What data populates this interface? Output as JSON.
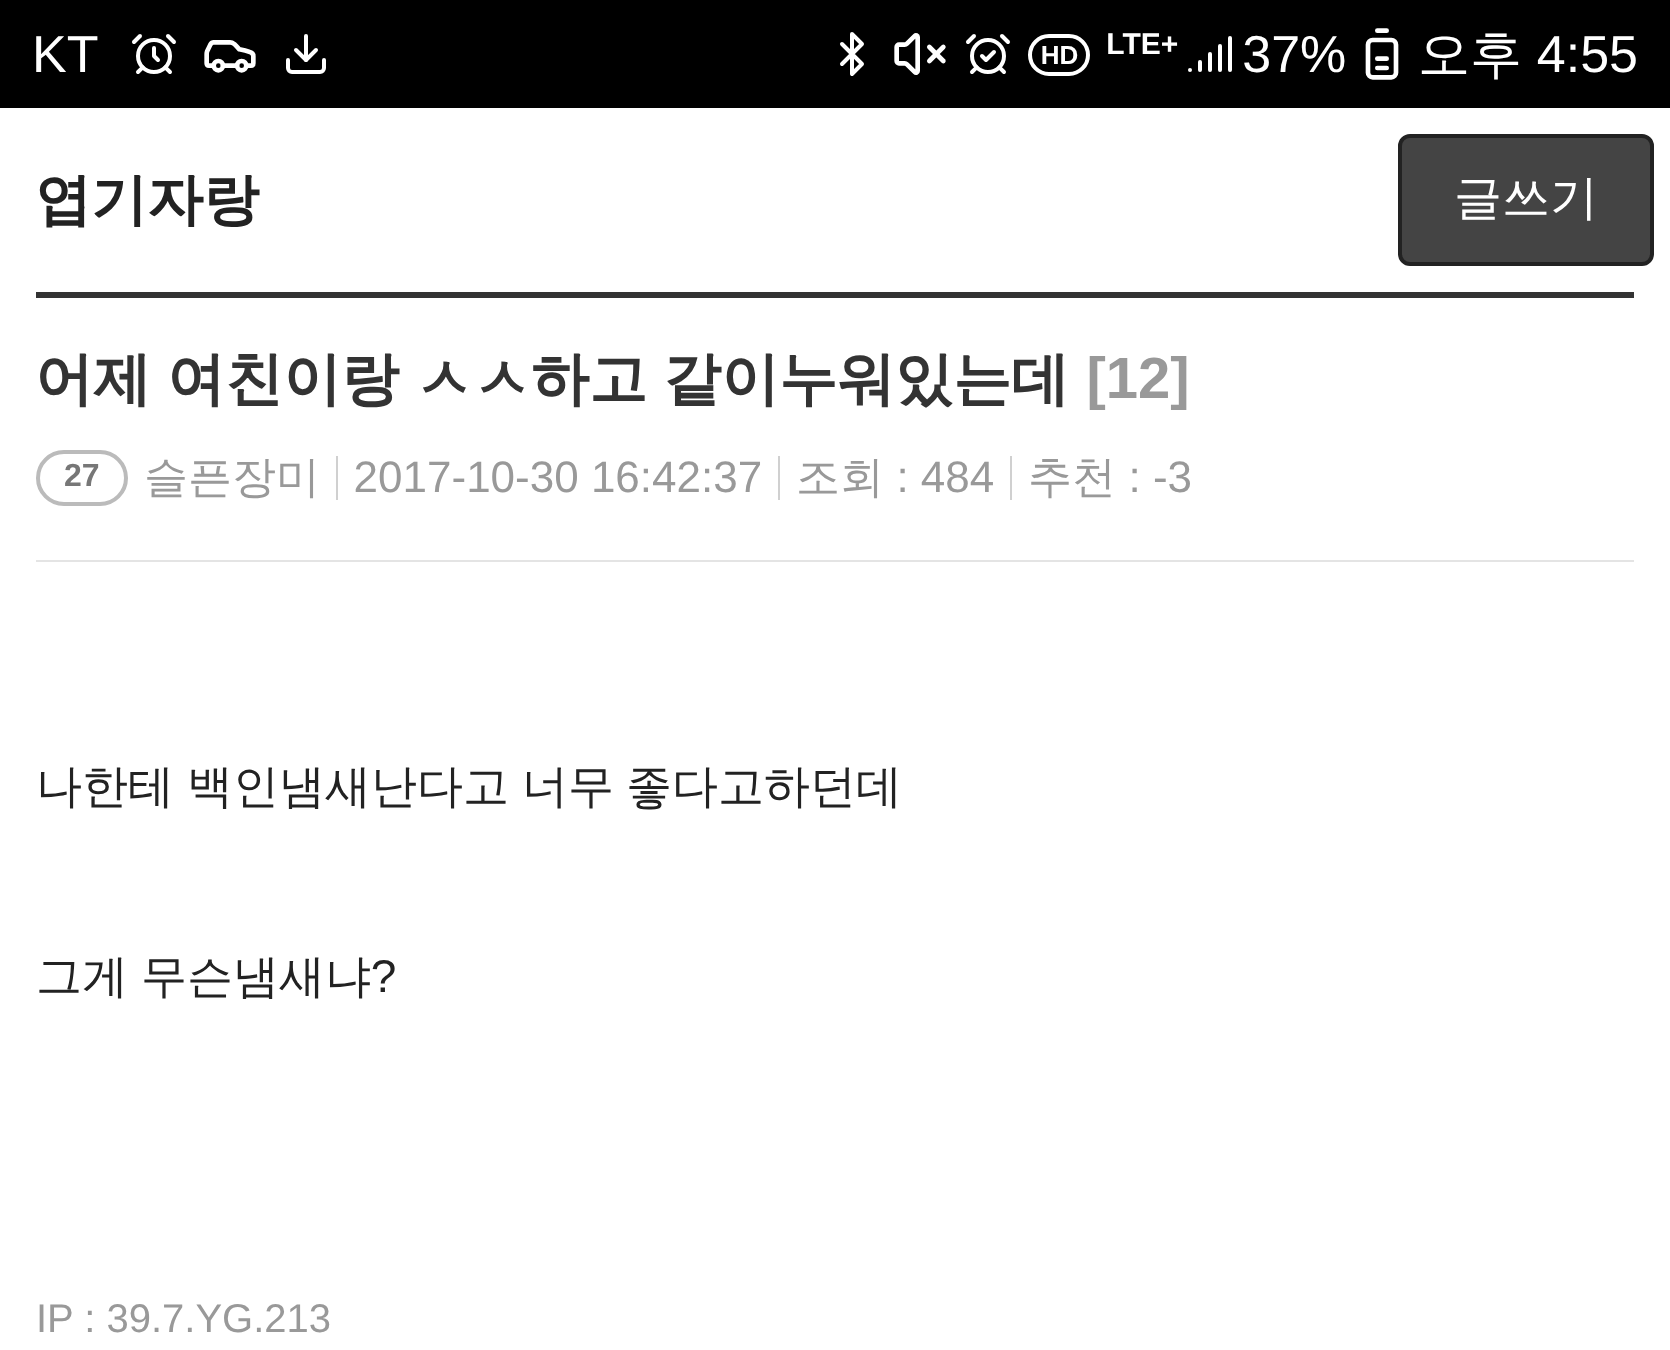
{
  "status_bar": {
    "carrier": "KT",
    "hd": "HD",
    "network": "LTE+",
    "battery": "37%",
    "time": "오후 4:55"
  },
  "header": {
    "title": "엽기자랑",
    "write_button": "글쓰기"
  },
  "post": {
    "title": "어제 여친이랑 ㅅㅅ하고 같이누워있는데",
    "comment_count": "[12]",
    "level_badge": "27",
    "author": "슬픈장미",
    "date": "2017-10-30 16:42:37",
    "views": "조회 : 484",
    "recommend": "추천 : -3",
    "body": [
      "나한테 백인냄새난다고 너무 좋다고하던데",
      "그게 무슨냄새냐?"
    ],
    "ip": "IP : 39.7.YG.213"
  }
}
